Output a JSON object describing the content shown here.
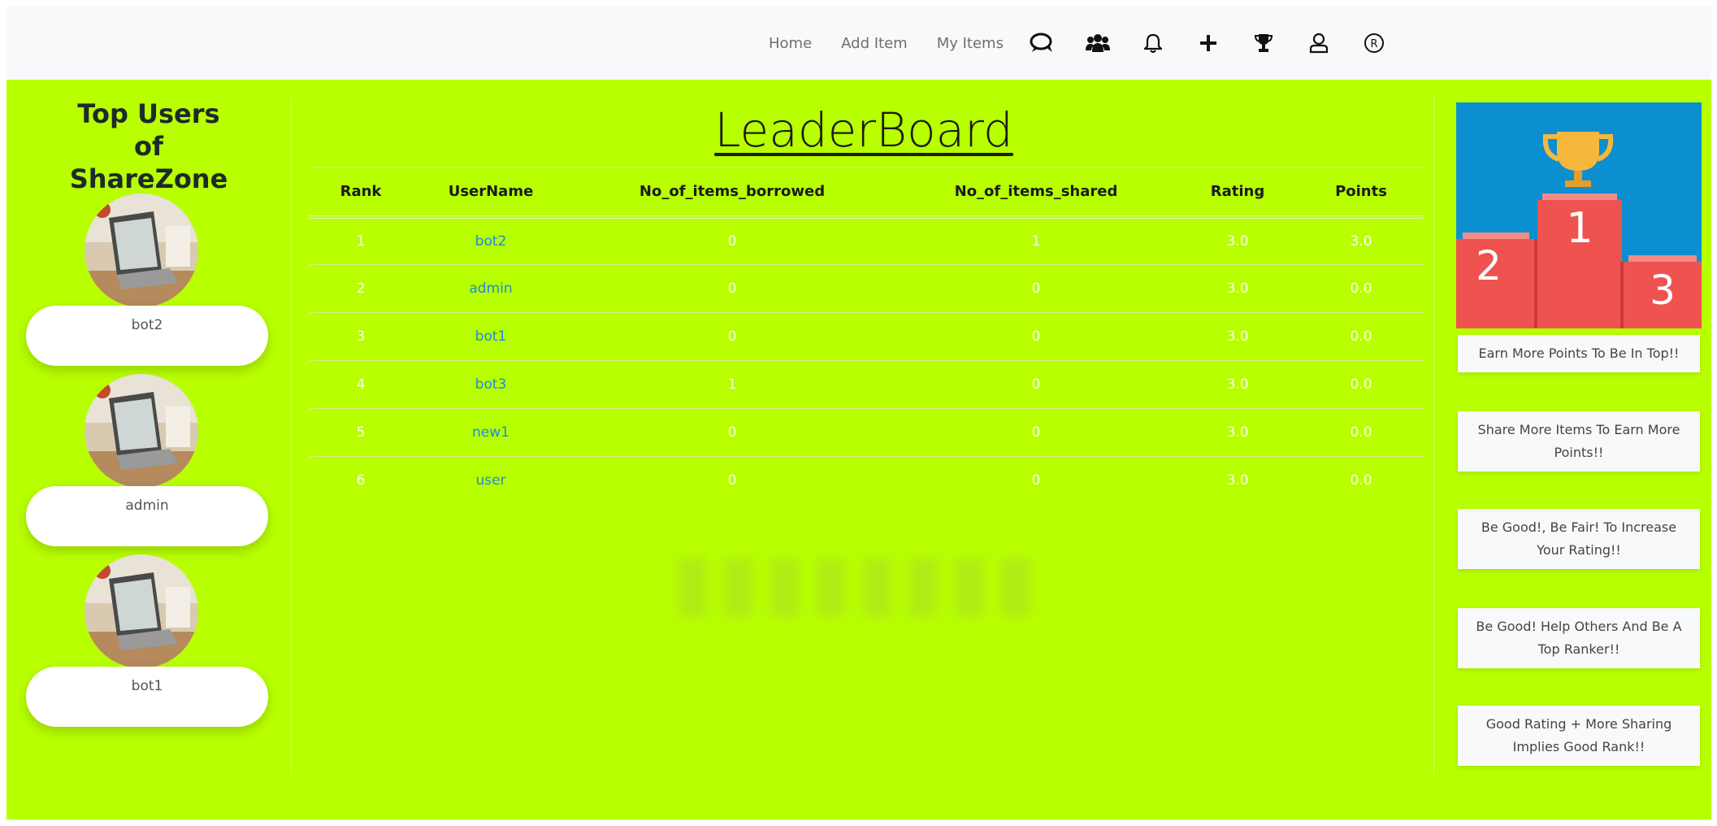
{
  "nav": {
    "links": [
      "Home",
      "Add Item",
      "My Items"
    ],
    "icons": [
      "chat-icon",
      "users-icon",
      "bell-icon",
      "plus-icon",
      "trophy-icon",
      "user-icon",
      "registered-icon"
    ]
  },
  "left": {
    "title": "Top Users of ShareZone",
    "top_users": [
      "bot2",
      "admin",
      "bot1"
    ]
  },
  "leaderboard": {
    "title": "LeaderBoard",
    "columns": [
      "Rank",
      "UserName",
      "No_of_items_borrowed",
      "No_of_items_shared",
      "Rating",
      "Points"
    ],
    "rows": [
      [
        "1",
        "bot2",
        "0",
        "1",
        "3.0",
        "3.0"
      ],
      [
        "2",
        "admin",
        "0",
        "0",
        "3.0",
        "0.0"
      ],
      [
        "3",
        "bot1",
        "0",
        "0",
        "3.0",
        "0.0"
      ],
      [
        "4",
        "bot3",
        "1",
        "0",
        "3.0",
        "0.0"
      ],
      [
        "5",
        "new1",
        "0",
        "0",
        "3.0",
        "0.0"
      ],
      [
        "6",
        "user",
        "0",
        "0",
        "3.0",
        "0.0"
      ]
    ]
  },
  "podium": {
    "places": [
      "1",
      "2",
      "3"
    ]
  },
  "tips": [
    "Earn More Points To Be In Top!!",
    "Share More Items To Earn More Points!!",
    "Be Good!, Be Fair! To Increase Your Rating!!",
    "Be Good! Help Others And Be A Top Ranker!!",
    "Good Rating + More Sharing Implies Good Rank!!"
  ],
  "colors": {
    "main_bg": "#b8ff00",
    "navbar_bg": "#f8f9fa",
    "link_blue": "#1e88e5",
    "podium_bg": "#0c8fd0",
    "podium_red": "#ef5350"
  }
}
